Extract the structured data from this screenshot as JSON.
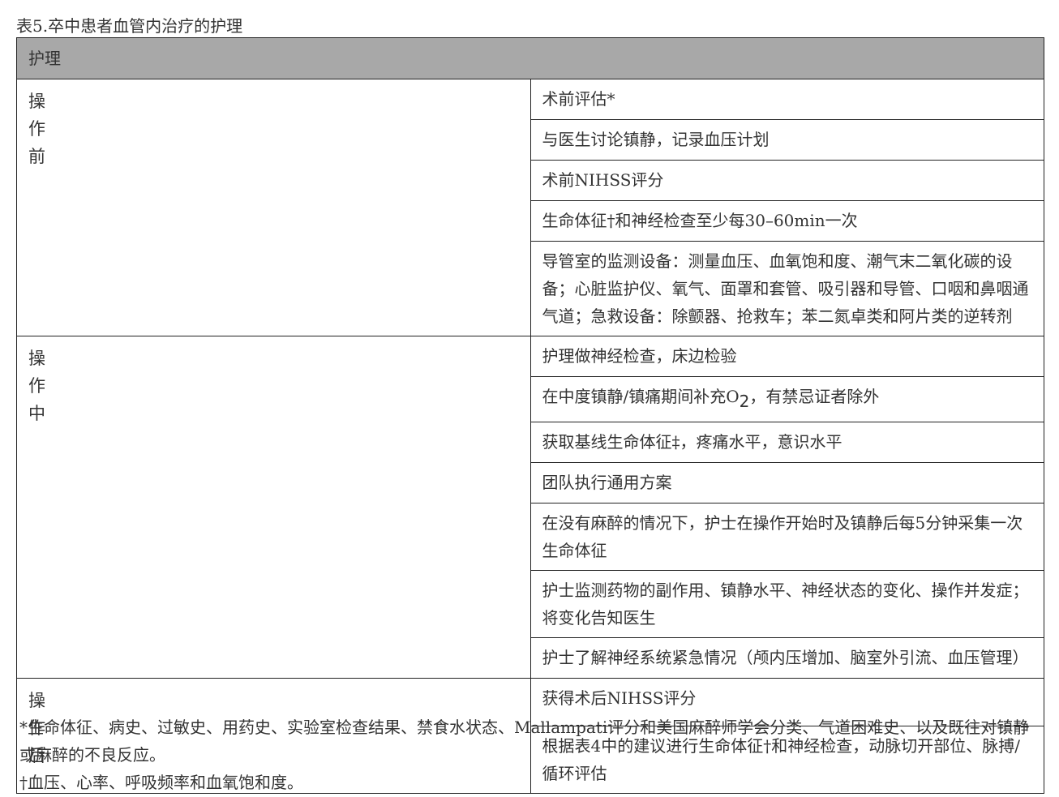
{
  "caption": "表5.卒中患者血管内治疗的护理",
  "table": {
    "header": "护理",
    "phases": [
      {
        "name": [
          "操",
          "作",
          "前"
        ],
        "items": [
          "术前评估*",
          "与医生讨论镇静，记录血压计划",
          "术前NIHSS评分",
          "生命体征†和神经检查至少每30–60min一次",
          "导管室的监测设备：测量血压、血氧饱和度、潮气末二氧化碳的设备；心脏监护仪、氧气、面罩和套管、吸引器和导管、口咽和鼻咽通气道；急救设备：除颤器、抢救车；苯二氮卓类和阿片类的逆转剂"
        ]
      },
      {
        "name": [
          "操",
          "作",
          "中"
        ],
        "items": [
          "护理做神经检查，床边检验",
          {
            "before": "在中度镇静/镇痛期间补充O",
            "sub": "2",
            "after": "，有禁忌证者除外"
          },
          "获取基线生命体征‡，疼痛水平，意识水平",
          "团队执行通用方案",
          "在没有麻醉的情况下，护士在操作开始时及镇静后每5分钟采集一次生命体征",
          "护士监测药物的副作用、镇静水平、神经状态的变化、操作并发症；将变化告知医生",
          "护士了解神经系统紧急情况（颅内压增加、脑室外引流、血压管理）"
        ]
      },
      {
        "name": [
          "操",
          "作",
          "后"
        ],
        "items": [
          "获得术后NIHSS评分",
          "根据表4中的建议进行生命体征†和神经检查，动脉切开部位、脉搏/循环评估"
        ]
      }
    ]
  },
  "footnotes": [
    "*生命体征、病史、过敏史、用药史、实验室检查结果、禁食水状态、Mallampati评分和美国麻醉师学会分类、气道困难史、以及既往对镇静或麻醉的不良反应。",
    "†血压、心率、呼吸频率和血氧饱和度。"
  ],
  "colors": {
    "header_bg": "#a8a8a8",
    "border": "#222222",
    "text": "#333333"
  }
}
